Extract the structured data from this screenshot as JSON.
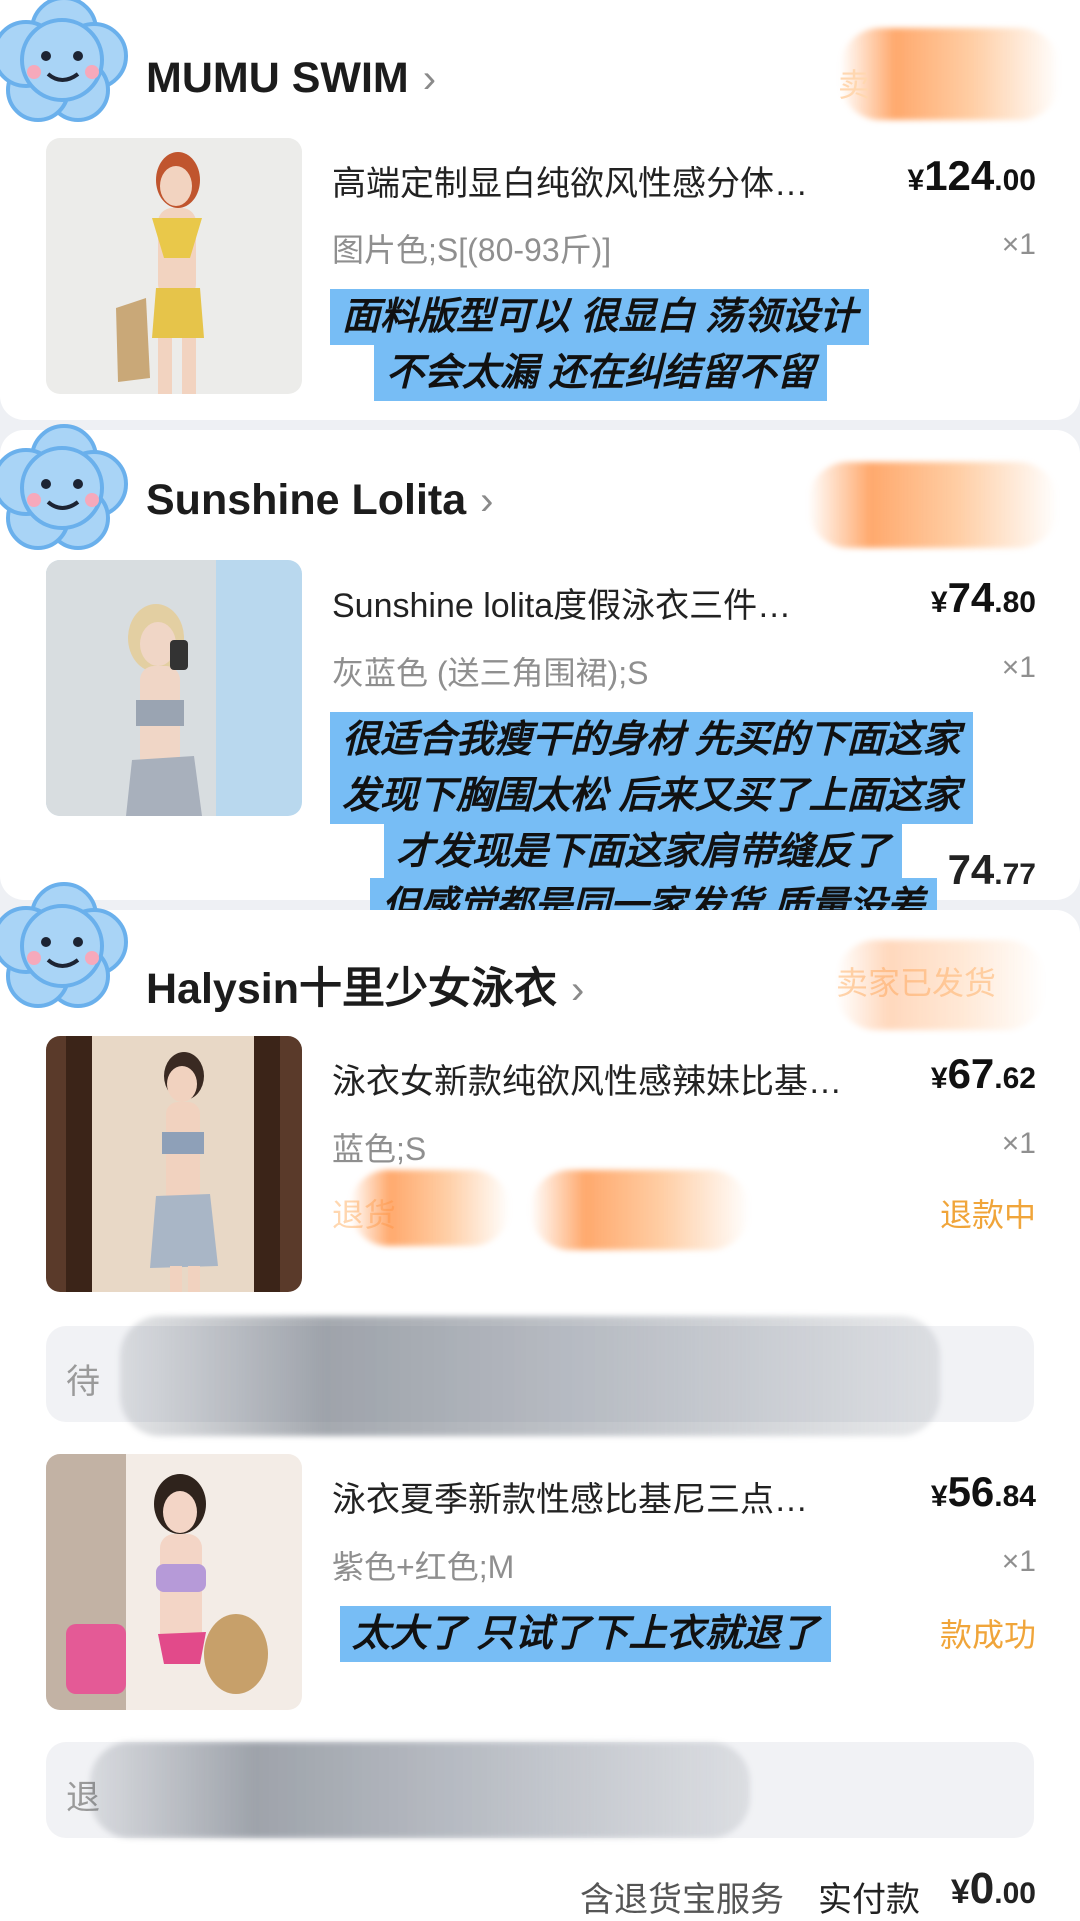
{
  "stores": [
    {
      "name": "MUMU SWIM",
      "status_hidden": "卖",
      "items": [
        {
          "title": "高端定制显白纯欲风性感分体…",
          "price_currency": "¥",
          "price_int": "124",
          "price_dec": ".00",
          "variant": "图片色;S[(80-93斤)]",
          "qty": "×1"
        }
      ],
      "caption_lines": [
        "面料版型可以 很显白 荡领设计",
        "不会太漏  还在纠结留不留"
      ]
    },
    {
      "name": "Sunshine Lolita",
      "items": [
        {
          "title": "Sunshine lolita度假泳衣三件…",
          "price_currency": "¥",
          "price_int": "74",
          "price_dec": ".80",
          "variant": "灰蓝色 (送三角围裙);S",
          "qty": "×1",
          "paid_int": "74",
          "paid_dec": ".77"
        }
      ],
      "caption_lines": [
        "很适合我瘦干的身材 先买的下面这家",
        "发现下胸围太松 后来又买了上面这家",
        "才发现是下面这家肩带缝反了",
        "但感觉都是同一家发货 质量没差"
      ]
    },
    {
      "name": "Halysin十里少女泳衣",
      "status": "卖家已发货",
      "items": [
        {
          "title": "泳衣女新款纯欲风性感辣妹比基…",
          "price_currency": "¥",
          "price_int": "67",
          "price_dec": ".62",
          "variant": "蓝色;S",
          "qty": "×1",
          "return_label": "退货",
          "status": "退款中"
        },
        {
          "title": "泳衣夏季新款性感比基尼三点…",
          "price_currency": "¥",
          "price_int": "56",
          "price_dec": ".84",
          "variant": "紫色+红色;M",
          "qty": "×1",
          "status": "款成功",
          "caption": "太大了 只试了下上衣就退了"
        }
      ],
      "info_pills": [
        "待",
        "退"
      ]
    }
  ],
  "footer": {
    "service_label": "含退货宝服务",
    "paid_label": "实付款",
    "paid_currency": "¥",
    "paid_int": "0",
    "paid_dec": ".00"
  },
  "colors": {
    "caption_bg": "#77bdf5",
    "status_orange": "#f0a53a",
    "background": "#eef0f4"
  },
  "icons": [
    "cloud-sticker-icon",
    "chevron-right-icon"
  ]
}
